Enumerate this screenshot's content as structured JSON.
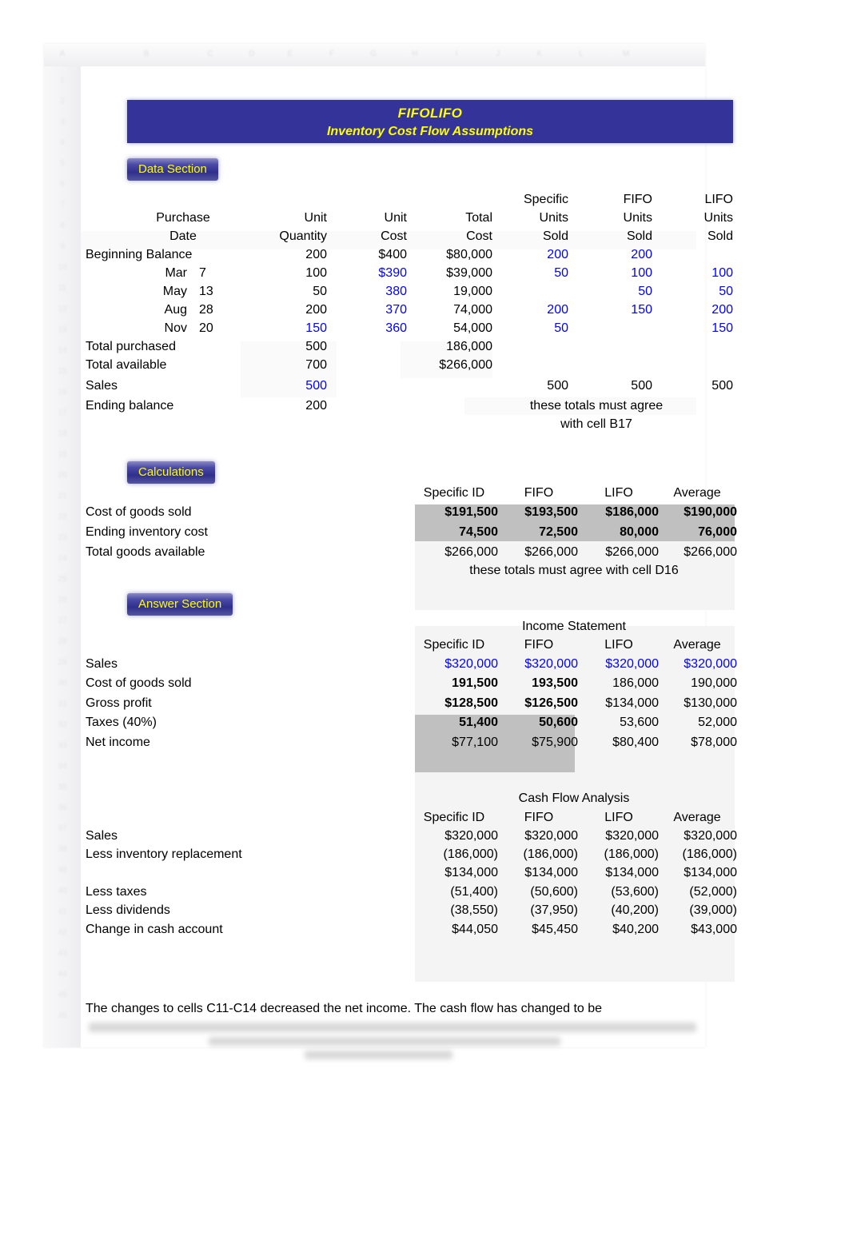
{
  "app": {
    "type": "spreadsheet",
    "colors": {
      "banner_bg": "#333399",
      "banner_text": "#ffff00",
      "badge_text": "#ffff00",
      "input_value": "#0000ff",
      "shaded_cell": "#c0c0c0"
    }
  },
  "column_headers": [
    "A",
    "B",
    "C",
    "D",
    "E",
    "F",
    "G",
    "H",
    "I",
    "J",
    "K",
    "L",
    "M"
  ],
  "row_headers": [
    "1",
    "2",
    "3",
    "4",
    "5",
    "6",
    "7",
    "8",
    "9",
    "10",
    "11",
    "12",
    "13",
    "14",
    "15",
    "16",
    "17",
    "18",
    "19",
    "20",
    "21",
    "22",
    "23",
    "24",
    "25",
    "26",
    "27",
    "28",
    "29",
    "30",
    "31",
    "32",
    "33",
    "34",
    "35",
    "36",
    "37",
    "38",
    "39",
    "40",
    "41",
    "42",
    "43",
    "44",
    "45",
    "46"
  ],
  "title": {
    "line1": "FIFOLIFO",
    "line2": "Inventory Cost Flow Assumptions"
  },
  "sections": {
    "data": "Data Section",
    "calculations": "Calculations",
    "answer": "Answer Section"
  },
  "data_section": {
    "headers": {
      "purchase": "Purchase",
      "date": "Date",
      "unit": "Unit",
      "quantity": "Quantity",
      "unit2": "Unit",
      "cost": "Cost",
      "total": "Total",
      "cost2": "Cost",
      "specific": "Specific",
      "specific_units": "Units",
      "specific_sold": "Sold",
      "fifo": "FIFO",
      "fifo_units": "Units",
      "fifo_sold": "Sold",
      "lifo": "LIFO",
      "lifo_units": "Units",
      "lifo_sold": "Sold"
    },
    "rows": [
      {
        "label": "Beginning Balance",
        "month": "",
        "day": "",
        "quantity": "200",
        "unit_cost": "$400",
        "total_cost": "$80,000",
        "specific_sold": "200",
        "fifo_sold": "200",
        "lifo_sold": "",
        "quantity_input": false,
        "unit_cost_input": false
      },
      {
        "label": "",
        "month": "Mar",
        "day": "7",
        "quantity": "100",
        "unit_cost": "$390",
        "total_cost": "$39,000",
        "specific_sold": "50",
        "fifo_sold": "100",
        "lifo_sold": "100",
        "quantity_input": false,
        "unit_cost_input": true
      },
      {
        "label": "",
        "month": "May",
        "day": "13",
        "quantity": "50",
        "unit_cost": "380",
        "total_cost": "19,000",
        "specific_sold": "",
        "fifo_sold": "50",
        "lifo_sold": "50",
        "quantity_input": false,
        "unit_cost_input": true
      },
      {
        "label": "",
        "month": "Aug",
        "day": "28",
        "quantity": "200",
        "unit_cost": "370",
        "total_cost": "74,000",
        "specific_sold": "200",
        "fifo_sold": "150",
        "lifo_sold": "200",
        "quantity_input": false,
        "unit_cost_input": true
      },
      {
        "label": "",
        "month": "Nov",
        "day": "20",
        "quantity": "150",
        "unit_cost": "360",
        "total_cost": "54,000",
        "specific_sold": "50",
        "fifo_sold": "",
        "lifo_sold": "150",
        "quantity_input": true,
        "unit_cost_input": true
      }
    ],
    "totals": {
      "total_purchased_label": "Total purchased",
      "total_purchased_qty": "500",
      "total_purchased_cost": "186,000",
      "total_available_label": "Total available",
      "total_available_qty": "700",
      "total_available_cost": "$266,000",
      "sales_label": "Sales",
      "sales_qty": "500",
      "sales_specific": "500",
      "sales_fifo": "500",
      "sales_lifo": "500",
      "ending_balance_label": "Ending balance",
      "ending_balance_qty": "200"
    },
    "note_line1": "these totals must agree",
    "note_line2": "with cell B17"
  },
  "calculations": {
    "col_headers": [
      "Specific ID",
      "FIFO",
      "LIFO",
      "Average"
    ],
    "rows": [
      {
        "label": "Cost of goods sold",
        "values": [
          "$191,500",
          "$193,500",
          "$186,000",
          "$190,000"
        ],
        "shaded": true,
        "bold": true
      },
      {
        "label": "Ending inventory cost",
        "values": [
          "74,500",
          "72,500",
          "80,000",
          "76,000"
        ],
        "shaded": true,
        "bold": true
      },
      {
        "label": "Total goods available",
        "values": [
          "$266,000",
          "$266,000",
          "$266,000",
          "$266,000"
        ],
        "shaded": false,
        "bold": false
      }
    ],
    "note": "these totals must agree with cell D16"
  },
  "income_statement": {
    "title": "Income Statement",
    "col_headers": [
      "Specific ID",
      "FIFO",
      "LIFO",
      "Average"
    ],
    "rows": [
      {
        "label": "Sales",
        "values": [
          "$320,000",
          "$320,000",
          "$320,000",
          "$320,000"
        ],
        "blue": true,
        "shaded": false,
        "bold": false
      },
      {
        "label": "Cost of goods sold",
        "values": [
          "191,500",
          "193,500",
          "186,000",
          "190,000"
        ],
        "blue": false,
        "shaded": true,
        "bold": true
      },
      {
        "label": "Gross profit",
        "values": [
          "$128,500",
          "$126,500",
          "$134,000",
          "$130,000"
        ],
        "blue": false,
        "shaded": true,
        "bold": true
      },
      {
        "label": "Taxes (40%)",
        "values": [
          "51,400",
          "50,600",
          "53,600",
          "52,000"
        ],
        "blue": false,
        "shaded": true,
        "bold": true
      },
      {
        "label": "Net income",
        "values": [
          "$77,100",
          "$75,900",
          "$80,400",
          "$78,000"
        ],
        "blue": false,
        "shaded": false,
        "bold": false
      }
    ]
  },
  "cash_flow": {
    "title": "Cash Flow Analysis",
    "col_headers": [
      "Specific ID",
      "FIFO",
      "LIFO",
      "Average"
    ],
    "rows": [
      {
        "label": "Sales",
        "values": [
          "$320,000",
          "$320,000",
          "$320,000",
          "$320,000"
        ]
      },
      {
        "label": "Less inventory replacement",
        "values": [
          "(186,000)",
          "(186,000)",
          "(186,000)",
          "(186,000)"
        ]
      },
      {
        "label": "",
        "values": [
          "$134,000",
          "$134,000",
          "$134,000",
          "$134,000"
        ]
      },
      {
        "label": "Less taxes",
        "values": [
          "(51,400)",
          "(50,600)",
          "(53,600)",
          "(52,000)"
        ]
      },
      {
        "label": "Less dividends",
        "values": [
          "(38,550)",
          "(37,950)",
          "(40,200)",
          "(39,000)"
        ]
      },
      {
        "label": "Change in cash account",
        "values": [
          "$44,050",
          "$45,450",
          "$40,200",
          "$43,000"
        ]
      }
    ]
  },
  "footer_note": {
    "line1": "The changes to cells C11-C14 decreased the net income. The cash flow has changed to be"
  }
}
